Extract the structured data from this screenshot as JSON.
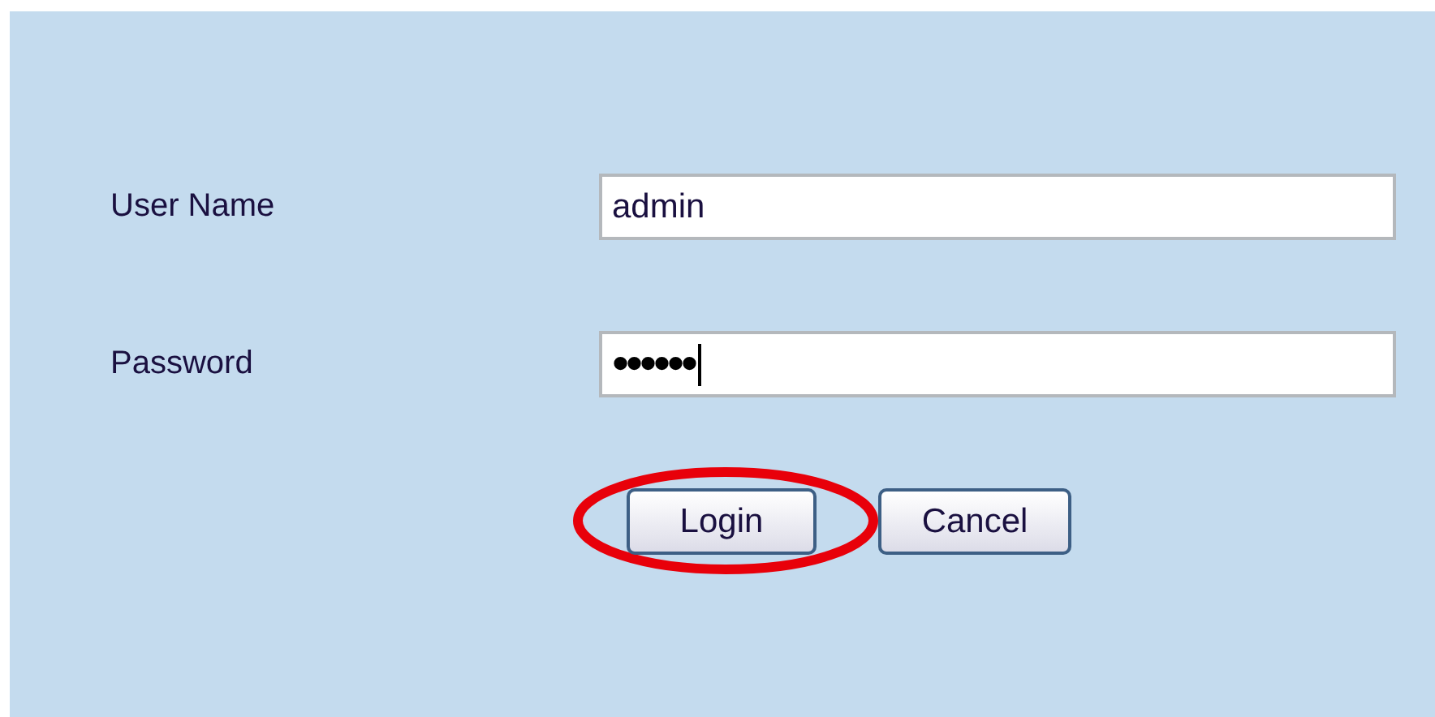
{
  "fields": [
    {
      "label": "User Name",
      "kind": "text",
      "value": "admin",
      "focused": false
    },
    {
      "label": "Password",
      "kind": "password",
      "value": "••••••",
      "focused": true
    }
  ],
  "buttons": [
    {
      "label": "Login",
      "highlighted": true
    },
    {
      "label": "Cancel",
      "highlighted": false
    }
  ]
}
